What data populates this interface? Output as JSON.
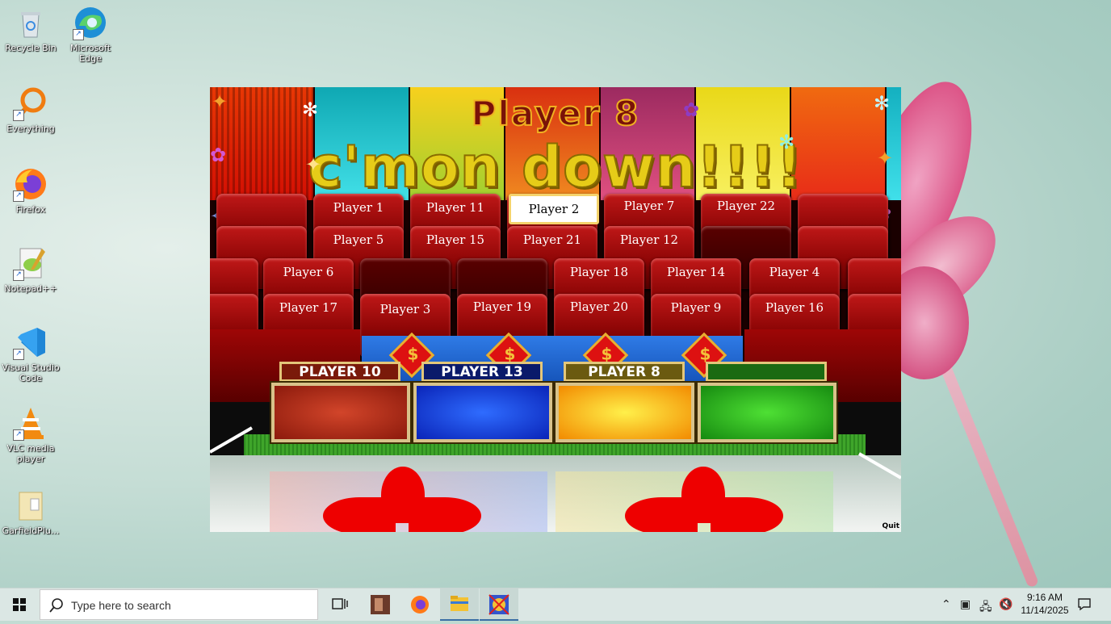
{
  "desktop": {
    "icons": [
      {
        "label": "Recycle Bin",
        "icon": "recycle-bin-icon"
      },
      {
        "label": "Microsoft Edge",
        "icon": "edge-icon"
      },
      {
        "label": "Everything",
        "icon": "everything-search-icon"
      },
      {
        "label": "Firefox",
        "icon": "firefox-icon"
      },
      {
        "label": "Notepad++",
        "icon": "notepad-plus-plus-icon"
      },
      {
        "label": "Visual Studio Code",
        "icon": "vscode-icon"
      },
      {
        "label": "VLC media player",
        "icon": "vlc-icon"
      },
      {
        "label": "GarfieldPlu...",
        "icon": "folder-icon"
      }
    ]
  },
  "game": {
    "headline": "Player 8",
    "subheadline": "c'mon down!!!!",
    "audience_rows": [
      [
        "Player 1",
        "Player 11",
        "Player 2",
        "Player 7",
        "Player 22"
      ],
      [
        "Player 5",
        "Player 15",
        "Player 21",
        "Player 12"
      ],
      [
        "Player 6",
        "Player 18",
        "Player 14",
        "Player 4"
      ],
      [
        "Player 17",
        "Player 3",
        "Player 19",
        "Player 20",
        "Player 9",
        "Player 16"
      ]
    ],
    "active_player": "Player 2",
    "money_symbol": "$",
    "contestants": [
      {
        "name": "PLAYER 10",
        "color": "#7a1a0a",
        "panel": "#b8321a"
      },
      {
        "name": "PLAYER 13",
        "color": "#0a1a6a",
        "panel": "#1340e0"
      },
      {
        "name": "PLAYER 8",
        "color": "#6b5a10",
        "panel": "#f2a800"
      },
      {
        "name": "",
        "color": "#1b6a12",
        "panel": "#27b01e"
      }
    ],
    "quit_label": "Quit"
  },
  "taskbar": {
    "search_placeholder": "Type here to search",
    "time": "9:16 AM",
    "date": "11/14/2025"
  }
}
